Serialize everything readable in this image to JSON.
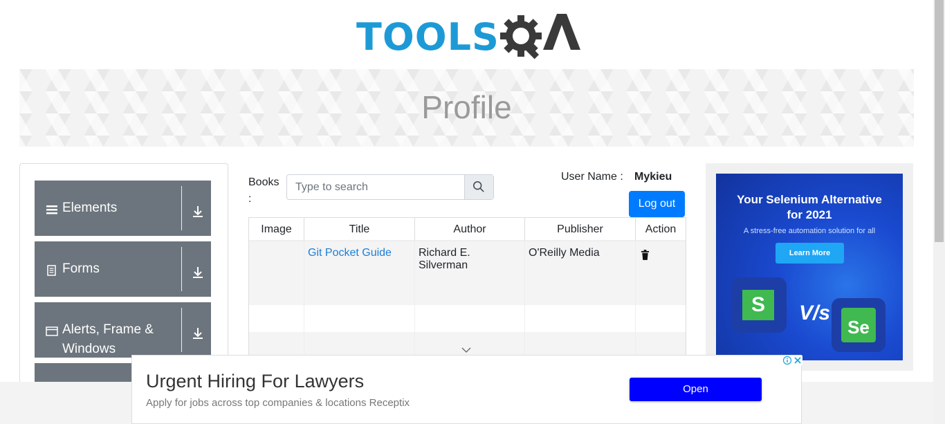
{
  "header": {
    "logo_text": "TOOLS",
    "logo_qa": "QA"
  },
  "banner": {
    "title": "Profile"
  },
  "sidebar": {
    "groups": [
      {
        "label": "Elements",
        "icon": "hamburger-icon"
      },
      {
        "label": "Forms",
        "icon": "document-icon"
      },
      {
        "label": "Alerts, Frame &",
        "label2": "Windows",
        "icon": "window-icon"
      }
    ]
  },
  "books": {
    "label": "Books",
    "colon": ":",
    "search_placeholder": "Type to search"
  },
  "user": {
    "label": "User Name :",
    "value": "Mykieu",
    "logout": "Log out"
  },
  "table": {
    "headers": [
      "Image",
      "Title",
      "Author",
      "Publisher",
      "Action"
    ],
    "rows": [
      {
        "title": "Git Pocket Guide",
        "author": "Richard E. Silverman",
        "publisher": "O'Reilly Media"
      }
    ]
  },
  "ad_right": {
    "headline1": "Your Selenium Alternative",
    "headline2": "for 2021",
    "subtitle": "A stress-free automation solution for all",
    "button": "Learn More",
    "vs": "V/s",
    "se": "Se",
    "s_logo": "S"
  },
  "bottom_ad": {
    "headline": "Urgent Hiring For Lawyers",
    "description": "Apply for jobs across top companies & locations Receptix",
    "button": "Open"
  },
  "colors": {
    "primary": "#007bff",
    "menu_bg": "#6c757d",
    "link": "#1c7ed6",
    "logo_blue": "#1d9ad6",
    "logo_dark": "#3a3a3a",
    "ad_button": "#0000ff"
  }
}
